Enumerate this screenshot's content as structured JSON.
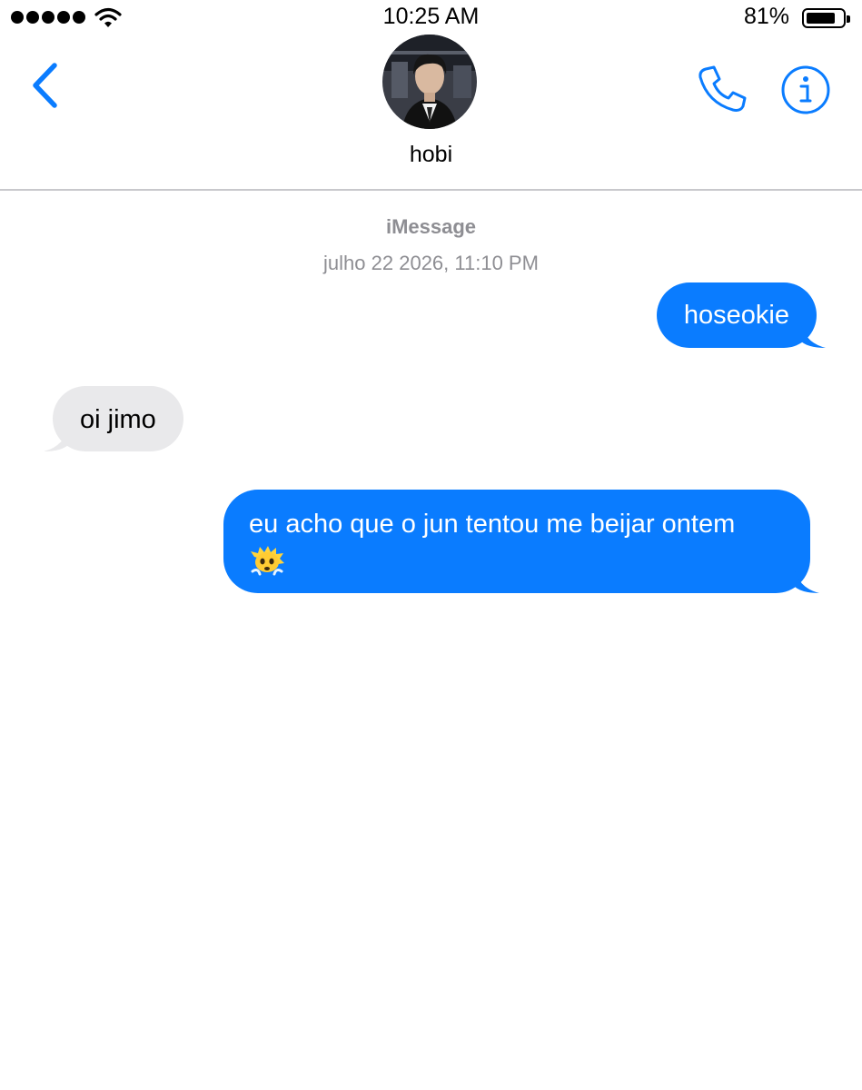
{
  "status_bar": {
    "time": "10:25 AM",
    "battery_percent": "81%",
    "battery_level": 0.81,
    "signal_bars": 5
  },
  "header": {
    "contact_name": "hobi",
    "avatar": "contact-photo",
    "back_icon": "chevron-left-icon",
    "call_icon": "phone-icon",
    "info_icon": "info-icon",
    "accent_color": "#0a7cff"
  },
  "conversation": {
    "service_label": "iMessage",
    "timestamp": "julho 22 2026, 11:10 PM",
    "messages": [
      {
        "direction": "sent",
        "text": "hoseokie"
      },
      {
        "direction": "received",
        "text": "oi jimo"
      },
      {
        "direction": "sent",
        "text": "eu acho que o jun tentou me beijar ontem",
        "emoji": "exploding-head-emoji"
      }
    ]
  },
  "colors": {
    "sent_bubble": "#0a7cff",
    "received_bubble": "#e9e9eb",
    "meta_text": "#8e8e93"
  }
}
